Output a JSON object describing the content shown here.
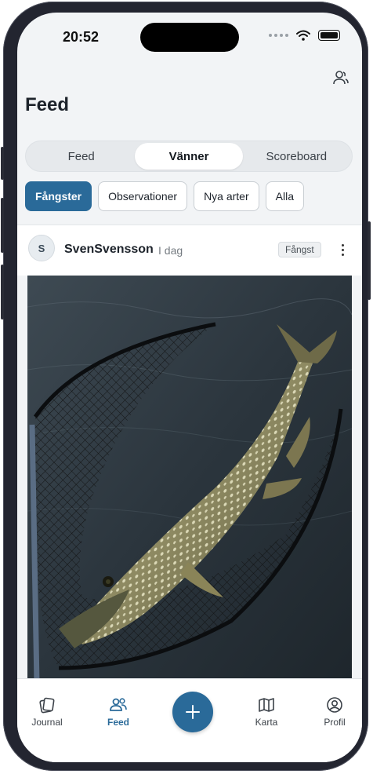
{
  "status_bar": {
    "time": "20:52"
  },
  "header": {
    "title": "Feed"
  },
  "segments": [
    {
      "label": "Feed",
      "active": false
    },
    {
      "label": "Vänner",
      "active": true
    },
    {
      "label": "Scoreboard",
      "active": false
    }
  ],
  "filters": [
    {
      "label": "Fångster",
      "active": true
    },
    {
      "label": "Observationer",
      "active": false
    },
    {
      "label": "Nya arter",
      "active": false
    },
    {
      "label": "Alla",
      "active": false
    }
  ],
  "post": {
    "avatar_initial": "S",
    "username": "SvenSvensson",
    "time": "I dag",
    "badge": "Fångst",
    "image_icon": "pike-in-net-photo"
  },
  "tabbar": {
    "items": [
      {
        "label": "Journal",
        "icon": "journal-icon",
        "active": false
      },
      {
        "label": "Feed",
        "icon": "people-icon",
        "active": true
      },
      {
        "label": "Karta",
        "icon": "map-icon",
        "active": false
      },
      {
        "label": "Profil",
        "icon": "profile-icon",
        "active": false
      }
    ],
    "add_icon": "plus-icon"
  },
  "colors": {
    "accent": "#2a6a99",
    "background": "#f2f4f6"
  }
}
